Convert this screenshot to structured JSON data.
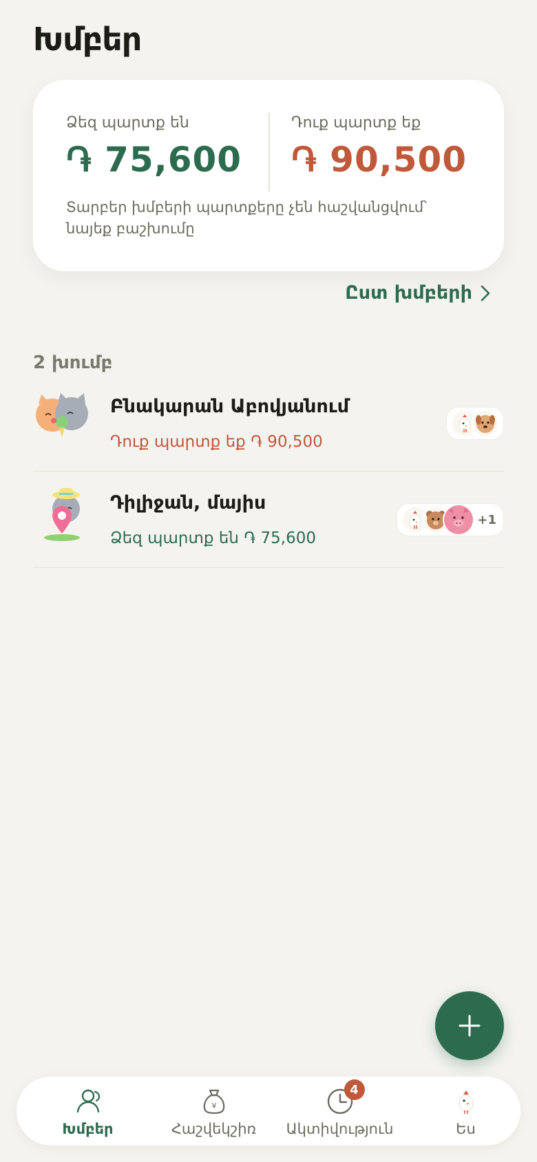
{
  "header": {
    "title": "Խմբեր"
  },
  "summary": {
    "owed_to_you_label": "Ձեզ պարտք են",
    "owed_to_you_amount": "֏ 75,600",
    "you_owe_label": "Դուք պարտք եք",
    "you_owe_amount": "֏ 90,500",
    "note": "Տարբեր խմբերի պարտքերը չեն հաշվանցվում՝ նայեք բաշխումը"
  },
  "by_groups_link": "Ըստ խմբերի",
  "groups_count": "2 խումբ",
  "groups": [
    {
      "name": "Բնակարան Աբովյանում",
      "status": "Դուք պարտք եք ֏ 90,500",
      "status_type": "owe",
      "extra_members": ""
    },
    {
      "name": "Դիլիջան, մայիս",
      "status": "Ձեզ պարտք են ֏ 75,600",
      "status_type": "owed",
      "extra_members": "+1"
    }
  ],
  "tabs": [
    {
      "label": "Խմբեր",
      "icon": "people-icon",
      "active": true
    },
    {
      "label": "Հաշվեկշիռ",
      "icon": "money-bag-icon",
      "active": false
    },
    {
      "label": "Ակտիվություն",
      "icon": "clock-icon",
      "active": false,
      "badge": "4"
    },
    {
      "label": "Ես",
      "icon": "chicken-avatar-icon",
      "active": false
    }
  ],
  "colors": {
    "accent": "#2d6b4f",
    "debt": "#c0583a",
    "background": "#f4f3ef"
  }
}
